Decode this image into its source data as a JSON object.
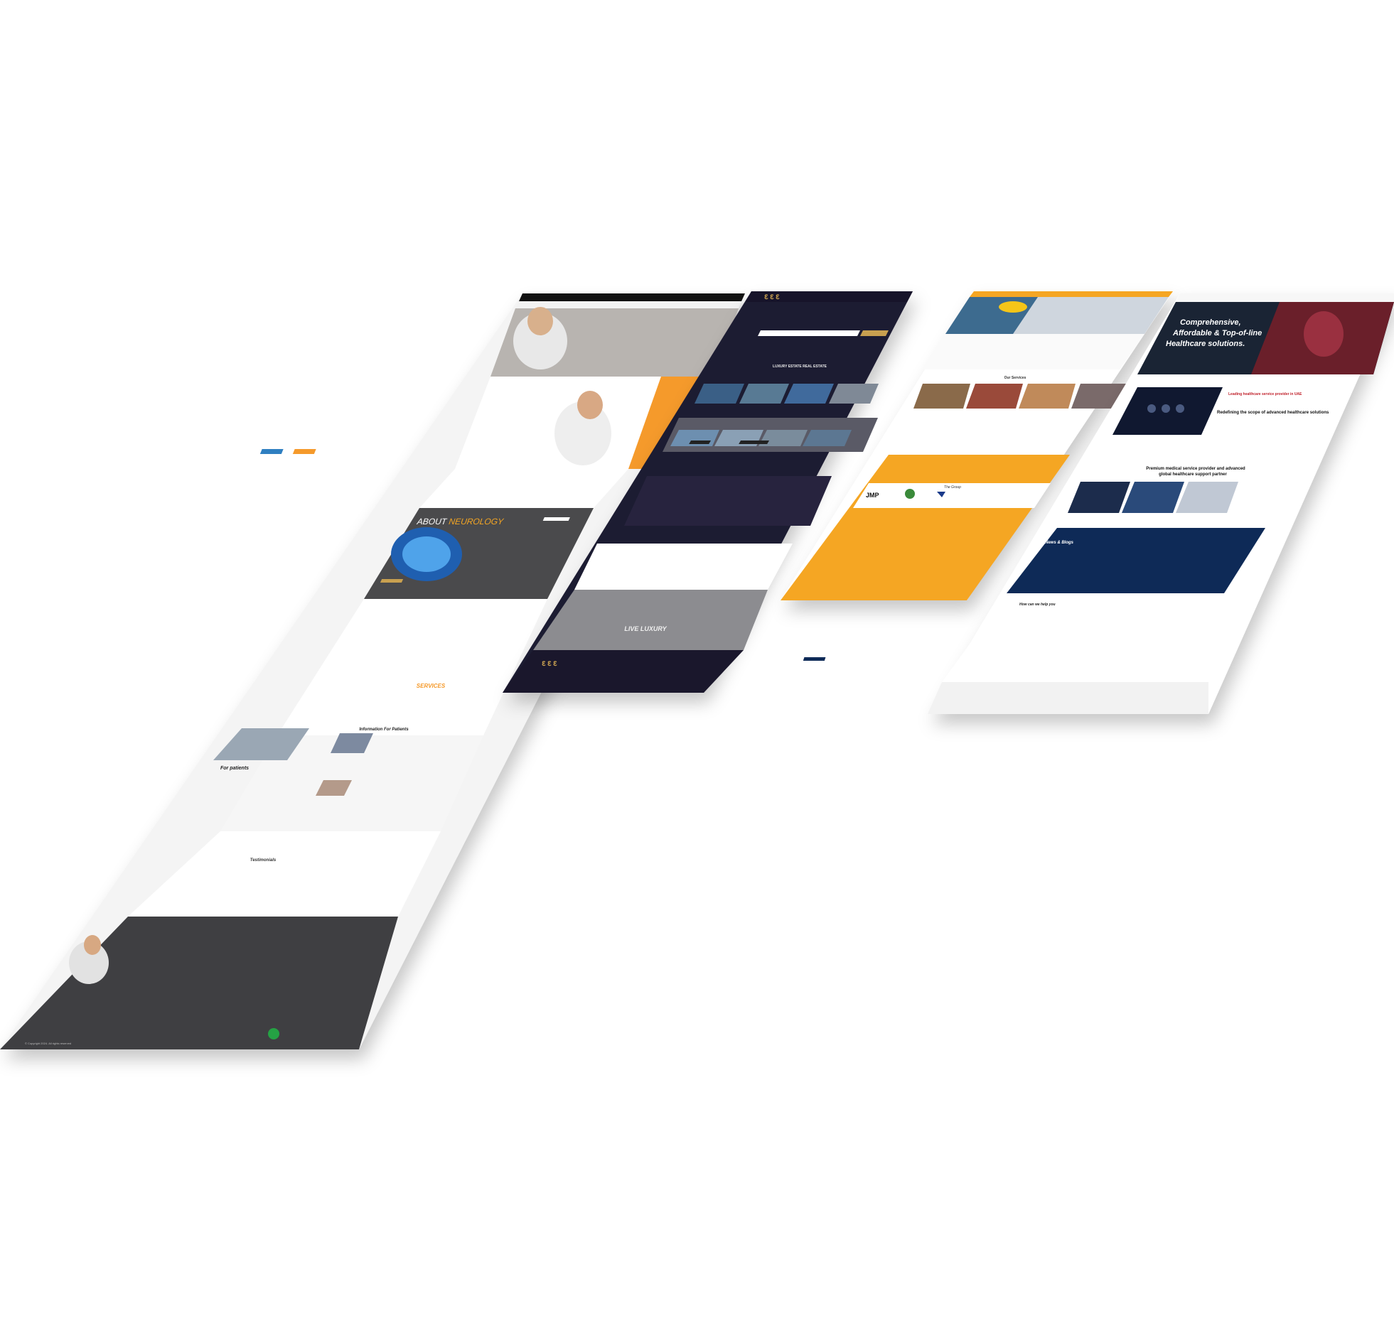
{
  "site1": {
    "about_title": "ABOUT",
    "about_title_accent": "NEUROLOGY",
    "services_title": "SERVICES",
    "info_title": "Information For Patients",
    "for_patients": "For patients",
    "testimonials_title": "Testimonials",
    "copyright": "© Copyright 2024. All rights reserved"
  },
  "site2": {
    "luxury_title": "LUXURY ESTATE REAL ESTATE",
    "live_luxury": "LIVE LUXURY"
  },
  "site3": {
    "our_services": "Our Services",
    "the_group": "The Group",
    "jmp_logo": "JMP"
  },
  "site4": {
    "hero_line1": "Comprehensive,",
    "hero_line2": "Affordable & Top-of-line",
    "hero_line3": "Healthcare solutions.",
    "leading": "Leading healthcare service provider in UAE",
    "redefining": "Redefining the scope of advanced healthcare solutions",
    "premium_line1": "Premium medical service provider and advanced",
    "premium_line2": "global healthcare support partner",
    "news": "News & Blogs",
    "how_help": "How can we help you"
  },
  "colors": {
    "orange": "#f5a623",
    "dark_navy": "#1e1a33",
    "navy_blue": "#0e2a57",
    "dark_grey": "#3f3f42",
    "red": "#c0202a"
  }
}
